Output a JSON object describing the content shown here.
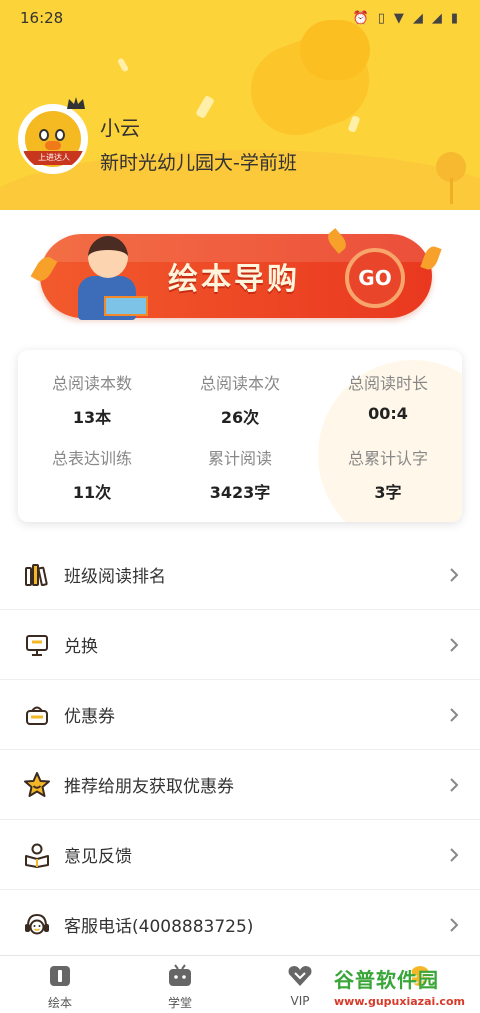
{
  "status_bar": {
    "time": "16:28",
    "icons": [
      "alarm-icon",
      "vibrate-icon",
      "wifi-icon",
      "signal-icon",
      "signal-icon",
      "battery-icon"
    ]
  },
  "profile": {
    "name": "小云",
    "class_name": "新时光幼儿园大-学前班",
    "avatar_badge": "上进达人"
  },
  "banner": {
    "title": "绘本导购",
    "go_label": "GO"
  },
  "stats": [
    {
      "label": "总阅读本数",
      "value": "13本"
    },
    {
      "label": "总阅读本次",
      "value": "26次"
    },
    {
      "label": "总阅读时长",
      "value": "00:4"
    },
    {
      "label": "总表达训练",
      "value": "11次"
    },
    {
      "label": "累计阅读",
      "value": "3423字"
    },
    {
      "label": "总累计认字",
      "value": "3字"
    }
  ],
  "menu": [
    {
      "label": "班级阅读排名",
      "icon": "books-icon"
    },
    {
      "label": "兑换",
      "icon": "exchange-icon"
    },
    {
      "label": "优惠券",
      "icon": "coupon-basket-icon"
    },
    {
      "label": "推荐给朋友获取优惠券",
      "icon": "star-smile-icon"
    },
    {
      "label": "意见反馈",
      "icon": "feedback-reader-icon"
    },
    {
      "label": "客服电话(4008883725)",
      "icon": "headset-icon"
    }
  ],
  "bottom_nav": [
    {
      "label": "绘本",
      "icon": "picture-book-icon"
    },
    {
      "label": "学堂",
      "icon": "tv-icon"
    },
    {
      "label": "VIP",
      "icon": "vip-heart-icon"
    },
    {
      "label": "",
      "icon": "profile-icon"
    }
  ],
  "watermark": {
    "title": "谷普软件园",
    "url": "www.gupuxiazai.com"
  },
  "colors": {
    "header_yellow": "#fdd33a",
    "banner_red": "#e9381f",
    "icon_dark": "#3b2a20",
    "icon_accent": "#f4b728"
  }
}
